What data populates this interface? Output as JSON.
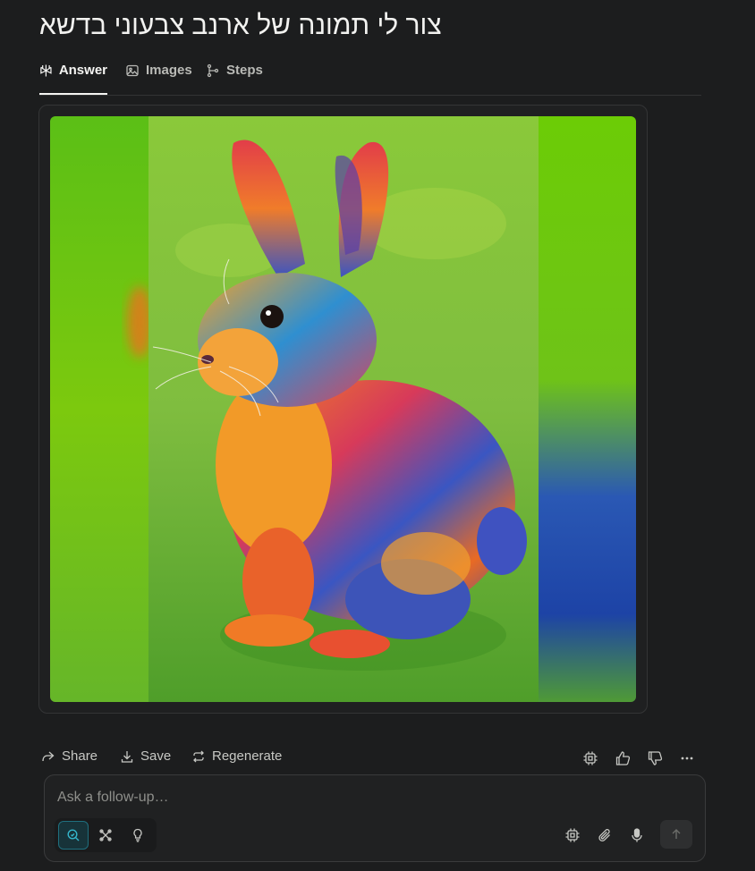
{
  "query": {
    "title": "צור לי תמונה של ארנב צבעוני בדשא"
  },
  "tabs": [
    {
      "label": "Answer",
      "icon": "perplexity-icon",
      "active": true
    },
    {
      "label": "Images",
      "icon": "image-icon",
      "active": false
    },
    {
      "label": "Steps",
      "icon": "steps-icon",
      "active": false
    }
  ],
  "result": {
    "image": "generated-rabbit-image"
  },
  "actions": {
    "share_label": "Share",
    "save_label": "Save",
    "regenerate_label": "Regenerate",
    "right_icons": [
      "cpu-icon",
      "thumbs-up-icon",
      "thumbs-down-icon",
      "more-icon"
    ]
  },
  "composer": {
    "placeholder": "Ask a follow-up…",
    "modes": [
      "search-icon",
      "research-icon",
      "lightbulb-icon"
    ],
    "tools": [
      "cpu-icon",
      "paperclip-icon",
      "microphone-icon"
    ],
    "send_icon": "arrow-up-icon"
  },
  "colors": {
    "background": "#1c1d1e",
    "accent": "#1f9fb5"
  }
}
